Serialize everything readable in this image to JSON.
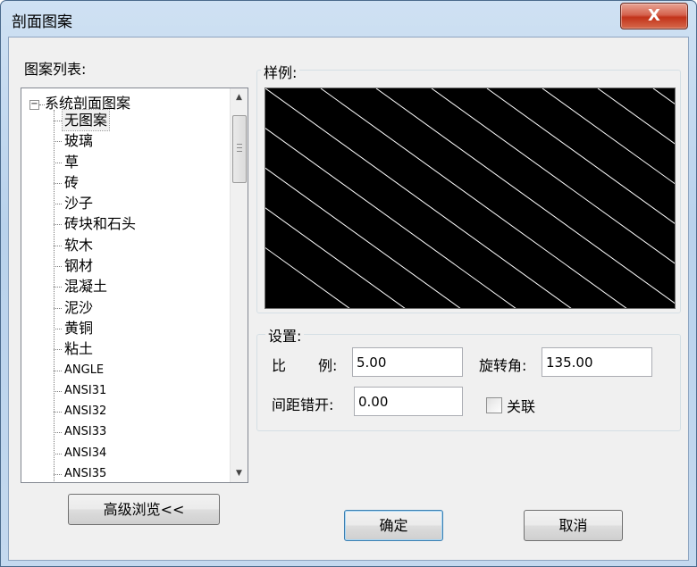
{
  "window": {
    "title": "剖面图案",
    "close_label": "X"
  },
  "pattern_list": {
    "label": "图案列表:",
    "root": "系统剖面图案",
    "items": [
      "无图案",
      "玻璃",
      "草",
      "砖",
      "沙子",
      "砖块和石头",
      "软木",
      "钢材",
      "混凝土",
      "泥沙",
      "黄铜",
      "粘土",
      "ANGLE",
      "ANSI31",
      "ANSI32",
      "ANSI33",
      "ANSI34",
      "ANSI35"
    ],
    "selected_index": 0
  },
  "preview": {
    "label": "样例:",
    "background": "#000000",
    "line_color": "#ffffff"
  },
  "settings": {
    "label": "设置:",
    "scale_label_1": "比",
    "scale_label_2": "例:",
    "scale_value": "5.00",
    "angle_label": "旋转角:",
    "angle_value": "135.00",
    "offset_label": "间距错开:",
    "offset_value": "0.00",
    "associate_label": "关联",
    "associate_checked": false
  },
  "buttons": {
    "advanced": "高级浏览<<",
    "ok": "确定",
    "cancel": "取消"
  }
}
